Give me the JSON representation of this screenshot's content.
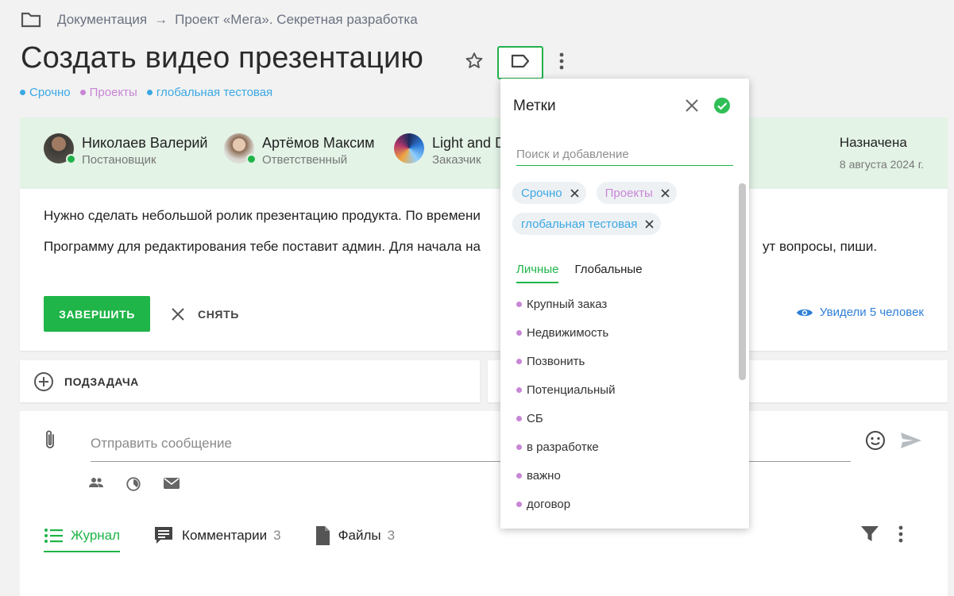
{
  "breadcrumb": {
    "folder_icon": "folder-icon",
    "root": "Документация",
    "separator": "→",
    "project": "Проект «Мега». Секретная разработка"
  },
  "task": {
    "title": "Создать видео презентацию",
    "labels": [
      {
        "name": "Срочно",
        "color": "#3aa8e4"
      },
      {
        "name": "Проекты",
        "color": "#c886d6"
      },
      {
        "name": "глобальная тестовая",
        "color": "#3aa8e4"
      }
    ]
  },
  "people": [
    {
      "name": "Николаев Валерий",
      "role": "Постановщик",
      "online": true
    },
    {
      "name": "Артёмов Максим",
      "role": "Ответственный",
      "online": true
    },
    {
      "name": "Light and D",
      "role": "Заказчик",
      "online": false
    }
  ],
  "assigned": {
    "label": "Назначена",
    "date": "8 августа 2024 г."
  },
  "description": {
    "line1": "Нужно сделать небольшой ролик презентацию продукта. По времени",
    "line2a": "Программу для редактирования тебе поставит админ. Для начала на",
    "line2b": "ут вопросы, пиши."
  },
  "actions": {
    "finish": "ЗАВЕРШИТЬ",
    "remove": "СНЯТЬ",
    "seen": "Увидели 5 человек"
  },
  "subtask": {
    "label": "ПОДЗАДАЧА"
  },
  "composer": {
    "placeholder": "Отправить сообщение"
  },
  "tabs": [
    {
      "label": "Журнал",
      "count": "",
      "icon": "list-icon"
    },
    {
      "label": "Комментарии",
      "count": "3",
      "icon": "comment-icon"
    },
    {
      "label": "Файлы",
      "count": "3",
      "icon": "file-icon"
    }
  ],
  "labels_popup": {
    "title": "Метки",
    "search_placeholder": "Поиск и добавление",
    "selected": [
      {
        "name": "Срочно",
        "color": "#3aa8e4"
      },
      {
        "name": "Проекты",
        "color": "#c886d6"
      },
      {
        "name": "глобальная тестовая",
        "color": "#3aa8e4"
      }
    ],
    "tabs": [
      "Личные",
      "Глобальные"
    ],
    "items": [
      "Крупный заказ",
      "Недвижимость",
      "Позвонить",
      "Потенциальный",
      "СБ",
      "в разработке",
      "важно",
      "договор"
    ]
  },
  "colors": {
    "accent": "#1fb548",
    "link": "#2f7fd6",
    "people_bg": "#e3f3e6"
  }
}
